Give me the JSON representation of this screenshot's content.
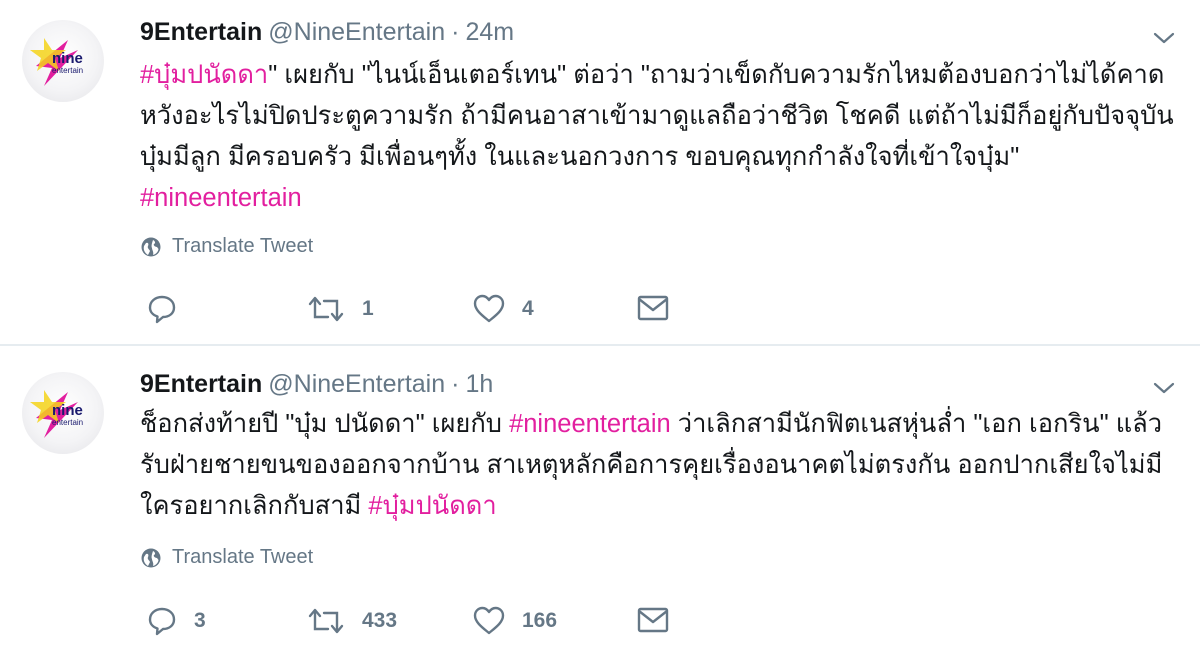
{
  "colors": {
    "hashtag": "#e21f9f",
    "muted": "#657786",
    "text": "#14171a",
    "divider": "#e6ecf0"
  },
  "tweets": [
    {
      "display_name": "9Entertain",
      "handle": "@NineEntertain",
      "separator": "·",
      "time": "24m",
      "avatar_logo_text": "nine entertain",
      "body": {
        "hashtag_start": "#บุ๋มปนัดดา",
        "text": "\" เผยกับ \"ไนน์เอ็นเตอร์เทน\" ต่อว่า \"ถามว่าเข็ดกับความรักไหมต้องบอกว่าไม่ได้คาดหวังอะไรไม่ปิดประตูความรัก ถ้ามีคนอาสาเข้ามาดูแลถือว่าชีวิต โชคดี แต่ถ้าไม่มีก็อยู่กับปัจจุบัน บุ๋มมีลูก มีครอบครัว มีเพื่อนๆทั้ง ในและนอกวงการ ขอบคุณทุกกำลังใจที่เข้าใจบุ๋ม\" ",
        "hashtag_end": "#nineentertain"
      },
      "translate_label": "Translate Tweet",
      "actions": {
        "reply": {
          "icon": "reply-icon",
          "count": ""
        },
        "retweet": {
          "icon": "retweet-icon",
          "count": "1"
        },
        "like": {
          "icon": "heart-icon",
          "count": "4"
        },
        "message": {
          "icon": "envelope-icon"
        }
      }
    },
    {
      "display_name": "9Entertain",
      "handle": "@NineEntertain",
      "separator": "·",
      "time": "1h",
      "avatar_logo_text": "nine entertain",
      "body": {
        "text_start": "ช็อกส่งท้ายปี \"บุ๋ม ปนัดดา\" เผยกับ ",
        "hashtag_mid": "#nineentertain",
        "text_mid": " ว่าเลิกสามีนักฟิตเนสหุ่นล่ำ \"เอก เอกริน\" แล้ว รับฝ่ายชายขนของออกจากบ้าน สาเหตุหลักคือการคุยเรื่องอนาคตไม่ตรงกัน ออกปากเสียใจไม่มีใครอยากเลิกกับสามี ",
        "hashtag_end": "#บุ๋มปนัดดา"
      },
      "translate_label": "Translate Tweet",
      "actions": {
        "reply": {
          "icon": "reply-icon",
          "count": "3"
        },
        "retweet": {
          "icon": "retweet-icon",
          "count": "433"
        },
        "like": {
          "icon": "heart-icon",
          "count": "166"
        },
        "message": {
          "icon": "envelope-icon"
        }
      }
    }
  ]
}
